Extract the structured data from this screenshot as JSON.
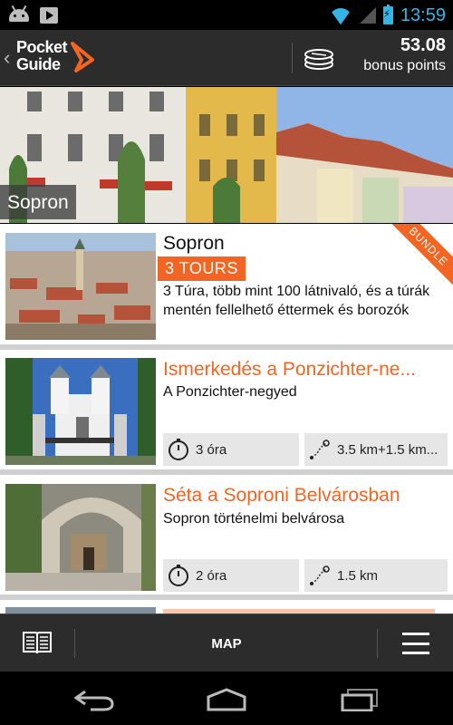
{
  "status_bar": {
    "time": "13:59",
    "icons": [
      "android-icon",
      "play-store-icon",
      "wifi-icon",
      "signal-icon",
      "battery-charging-icon"
    ]
  },
  "app_bar": {
    "logo_line1": "Pocket",
    "logo_line2": "Guide",
    "points_value": "53.08",
    "points_label": "bonus points",
    "accent_color": "#f26522"
  },
  "hero": {
    "label": "Sopron"
  },
  "cards": [
    {
      "title": "Sopron",
      "tag": "3 TOURS",
      "ribbon": "BUNDLE",
      "description": "3 Túra, több mint 100 látnivaló, és a túrák mentén fellelhető éttermek és borozók"
    },
    {
      "title": "Ismerkedés a Ponzichter-ne...",
      "subtitle": "A Ponzichter-negyed",
      "duration": "3 óra",
      "distance": "3.5 km+1.5 km..."
    },
    {
      "title": "Séta a Soproni Belvárosban",
      "subtitle": "Sopron történelmi belvárosa",
      "duration": "2 óra",
      "distance": "1.5 km"
    }
  ],
  "bottom_bar": {
    "map_label": "MAP"
  }
}
